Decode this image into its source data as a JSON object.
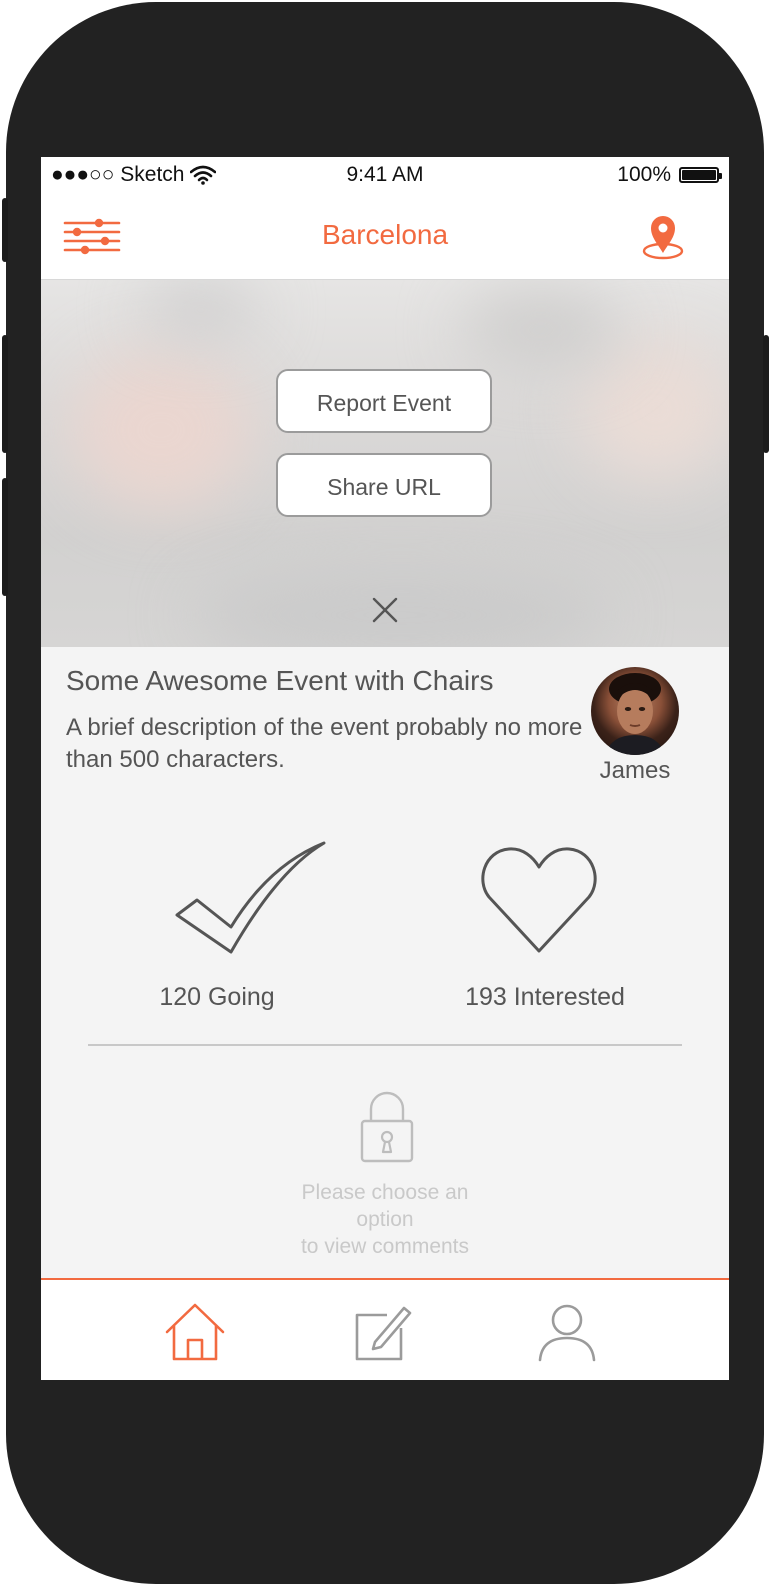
{
  "status_bar": {
    "carrier": "●●●○○ Sketch",
    "time": "9:41 AM",
    "battery": "100%"
  },
  "nav": {
    "title": "Barcelona",
    "left_icon": "sliders-filter-icon",
    "right_icon": "map-pin-icon"
  },
  "overlay": {
    "report_label": "Report Event",
    "share_label": "Share URL",
    "close_icon": "close-icon"
  },
  "event": {
    "title": "Some Awesome Event with Chairs",
    "description": "A brief description of the event probably no more than 500 characters.",
    "host_name": "James"
  },
  "actions": {
    "going_label": "120 Going",
    "interested_label": "193 Interested"
  },
  "comments": {
    "locked_line1": "Please choose an",
    "locked_line2": "option",
    "locked_line3": "to view comments"
  },
  "tabs": [
    {
      "icon": "home-icon",
      "active": true
    },
    {
      "icon": "compose-icon",
      "active": false
    },
    {
      "icon": "profile-icon",
      "active": false
    }
  ],
  "colors": {
    "accent": "#f26a40",
    "text": "#555555",
    "muted": "#c9c9c9",
    "background": "#f4f4f4"
  }
}
